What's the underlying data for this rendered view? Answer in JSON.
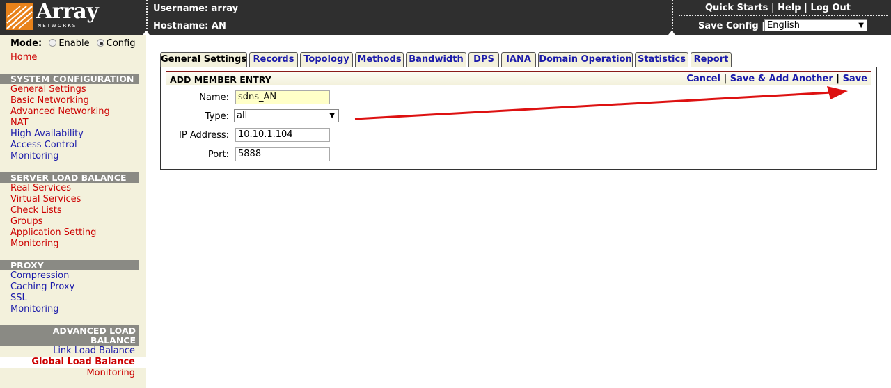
{
  "header": {
    "logo_text": "Array",
    "logo_sub": "NETWORKS",
    "username_label": "Username: array",
    "hostname_label": "Hostname: AN",
    "links": [
      "Quick Starts",
      "Help",
      "Log Out"
    ],
    "link_sep": "|",
    "save_config": "Save Config |",
    "language": "English"
  },
  "sidebar": {
    "mode_label": "Mode:",
    "mode_options": [
      "Enable",
      "Config"
    ],
    "mode_selected": "Config",
    "home": "Home",
    "sections": [
      {
        "title": "SYSTEM CONFIGURATION",
        "items": [
          "General Settings",
          "Basic Networking",
          "Advanced Networking",
          "NAT",
          "High Availability",
          "Access Control",
          "Monitoring"
        ]
      },
      {
        "title": "SERVER LOAD BALANCE",
        "items": [
          "Real Services",
          "Virtual Services",
          "Check Lists",
          "Groups",
          "Application Setting",
          "Monitoring"
        ]
      },
      {
        "title": "PROXY",
        "items": [
          "Compression",
          "Caching Proxy",
          "SSL",
          "Monitoring"
        ]
      },
      {
        "title_line1": "ADVANCED LOAD",
        "title_line2": "BALANCE",
        "items": [
          "Link Load Balance",
          "Global Load Balance",
          "Monitoring"
        ],
        "active": "Global Load Balance"
      }
    ]
  },
  "tabs": [
    "General Settings",
    "Records",
    "Topology",
    "Methods",
    "Bandwidth",
    "DPS",
    "IANA",
    "Domain Operation",
    "Statistics",
    "Report"
  ],
  "active_tab": "General Settings",
  "form": {
    "title": "ADD MEMBER ENTRY",
    "actions": [
      "Cancel",
      "Save & Add Another",
      "Save"
    ],
    "fields": {
      "name": {
        "label": "Name:",
        "value": "sdns_AN"
      },
      "type": {
        "label": "Type:",
        "value": "all"
      },
      "ip": {
        "label": "IP Address:",
        "value": "10.10.1.104"
      },
      "port": {
        "label": "Port:",
        "value": "5888"
      }
    }
  },
  "colors": {
    "header_bg": "#2f2f2f",
    "sidebar_bg": "#f3f1dc",
    "section_bg": "#8a8a84",
    "link_red": "#cc0000",
    "link_blue": "#1a1aaa",
    "annotation_arrow": "#dd1111"
  }
}
